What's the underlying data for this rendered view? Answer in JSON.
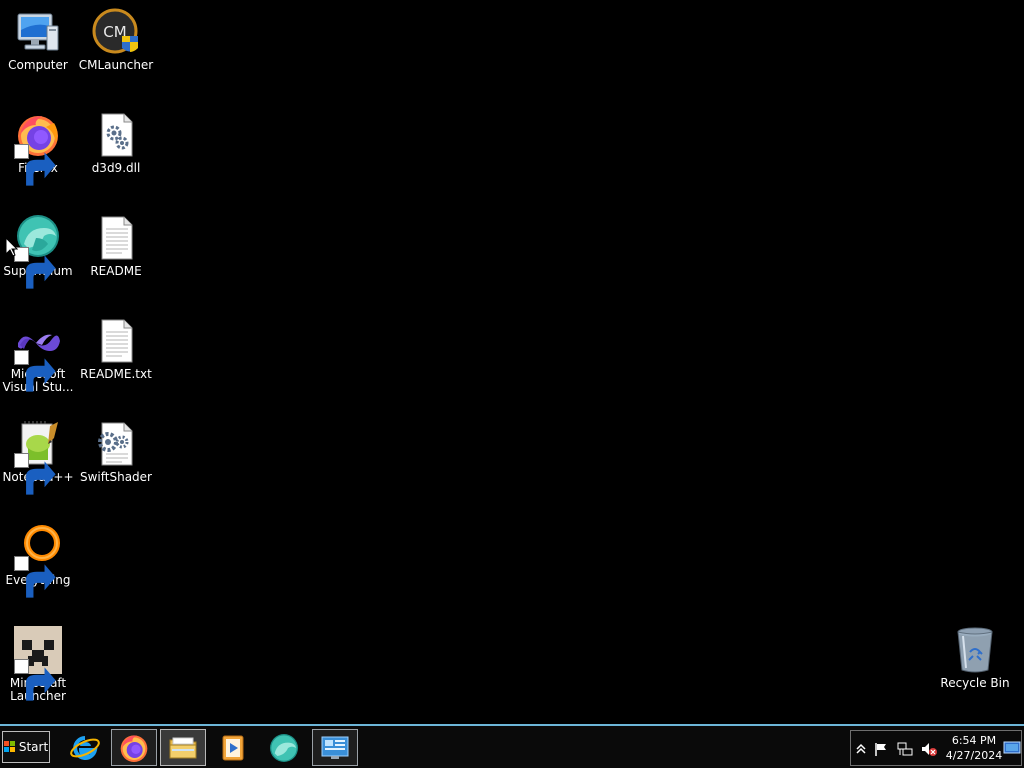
{
  "desktop": {
    "icons": [
      {
        "id": "computer",
        "label": "Computer",
        "icon": "computer-icon",
        "shortcut": false
      },
      {
        "id": "cmlauncher",
        "label": "CMLauncher",
        "icon": "cmlauncher-icon",
        "shortcut": false
      },
      {
        "id": "firefox",
        "label": "Firefox",
        "icon": "firefox-icon",
        "shortcut": true
      },
      {
        "id": "d3d9",
        "label": "d3d9.dll",
        "icon": "dll-file-icon",
        "shortcut": false
      },
      {
        "id": "supermium",
        "label": "Supermium",
        "icon": "supermium-icon",
        "shortcut": true
      },
      {
        "id": "readme",
        "label": "README",
        "icon": "text-file-icon",
        "shortcut": false
      },
      {
        "id": "msvs",
        "label": "Microsoft\nVisual Stu...",
        "icon": "visual-studio-icon",
        "shortcut": true
      },
      {
        "id": "readme-txt",
        "label": "README.txt",
        "icon": "text-file-icon",
        "shortcut": false
      },
      {
        "id": "notepadpp",
        "label": "Notepad++",
        "icon": "notepadpp-icon",
        "shortcut": true
      },
      {
        "id": "swiftshader",
        "label": "SwiftShader",
        "icon": "settings-file-icon",
        "shortcut": false
      },
      {
        "id": "everything",
        "label": "Everything",
        "icon": "everything-icon",
        "shortcut": true
      },
      {
        "id": "minecraft",
        "label": "Minecraft\nLauncher",
        "icon": "minecraft-icon",
        "shortcut": true
      },
      {
        "id": "recycle-bin",
        "label": "Recycle Bin",
        "icon": "recycle-bin-icon",
        "shortcut": false
      }
    ]
  },
  "taskbar": {
    "start_label": "Start",
    "pinned": [
      {
        "name": "internet-explorer",
        "icon": "internet-explorer-icon"
      },
      {
        "name": "firefox",
        "icon": "firefox-icon",
        "state": "active"
      },
      {
        "name": "file-explorer",
        "icon": "folder-icon",
        "state": "pressed"
      },
      {
        "name": "media-player",
        "icon": "media-player-icon"
      },
      {
        "name": "supermium",
        "icon": "supermium-icon"
      },
      {
        "name": "remote-desktop",
        "icon": "remote-desktop-icon",
        "state": "active"
      }
    ],
    "tray": {
      "icons": [
        "show-hidden-icons-chevron",
        "action-center-flag-icon",
        "network-icon",
        "volume-muted-icon"
      ],
      "time": "6:54 PM",
      "date": "4/27/2024"
    }
  },
  "colors": {
    "taskbar_border": "#6db6d8",
    "desktop_bg": "#000000"
  }
}
